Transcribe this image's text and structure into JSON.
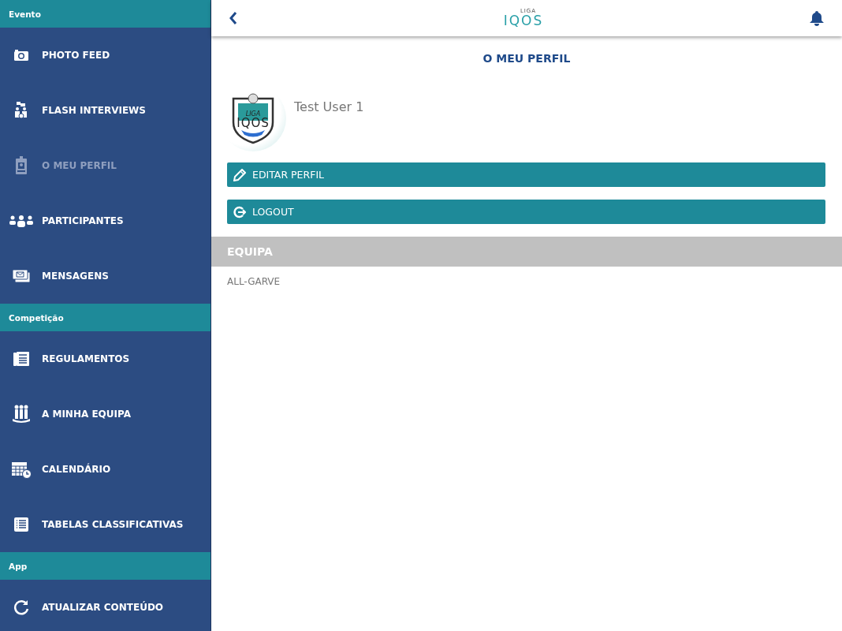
{
  "sidebar": {
    "sections": [
      {
        "title": "Evento",
        "items": [
          {
            "label": "PHOTO FEED",
            "selected": false
          },
          {
            "label": "FLASH INTERVIEWS",
            "selected": false
          },
          {
            "label": "O MEU PERFIL",
            "selected": true
          },
          {
            "label": "PARTICIPANTES",
            "selected": false
          },
          {
            "label": "MENSAGENS",
            "selected": false
          }
        ]
      },
      {
        "title": "Competição",
        "items": [
          {
            "label": "REGULAMENTOS",
            "selected": false
          },
          {
            "label": "A MINHA EQUIPA",
            "selected": false
          },
          {
            "label": "CALENDÁRIO",
            "selected": false
          },
          {
            "label": "TABELAS CLASSIFICATIVAS",
            "selected": false
          }
        ]
      },
      {
        "title": "App",
        "items": [
          {
            "label": "ATUALIZAR CONTEÚDO",
            "selected": false
          }
        ]
      }
    ]
  },
  "header": {
    "logo_small": "LIGA",
    "logo_large": "IQOS"
  },
  "page_title": "O MEU PERFIL",
  "profile": {
    "name": "Test User 1",
    "avatar_small": "LIGA",
    "avatar_large": "IQOS"
  },
  "buttons": [
    {
      "label": "EDITAR PERFIL",
      "kind": "edit"
    },
    {
      "label": "LOGOUT",
      "kind": "logout"
    }
  ],
  "team": {
    "heading": "EQUIPA",
    "value": "ALL-GARVE"
  }
}
